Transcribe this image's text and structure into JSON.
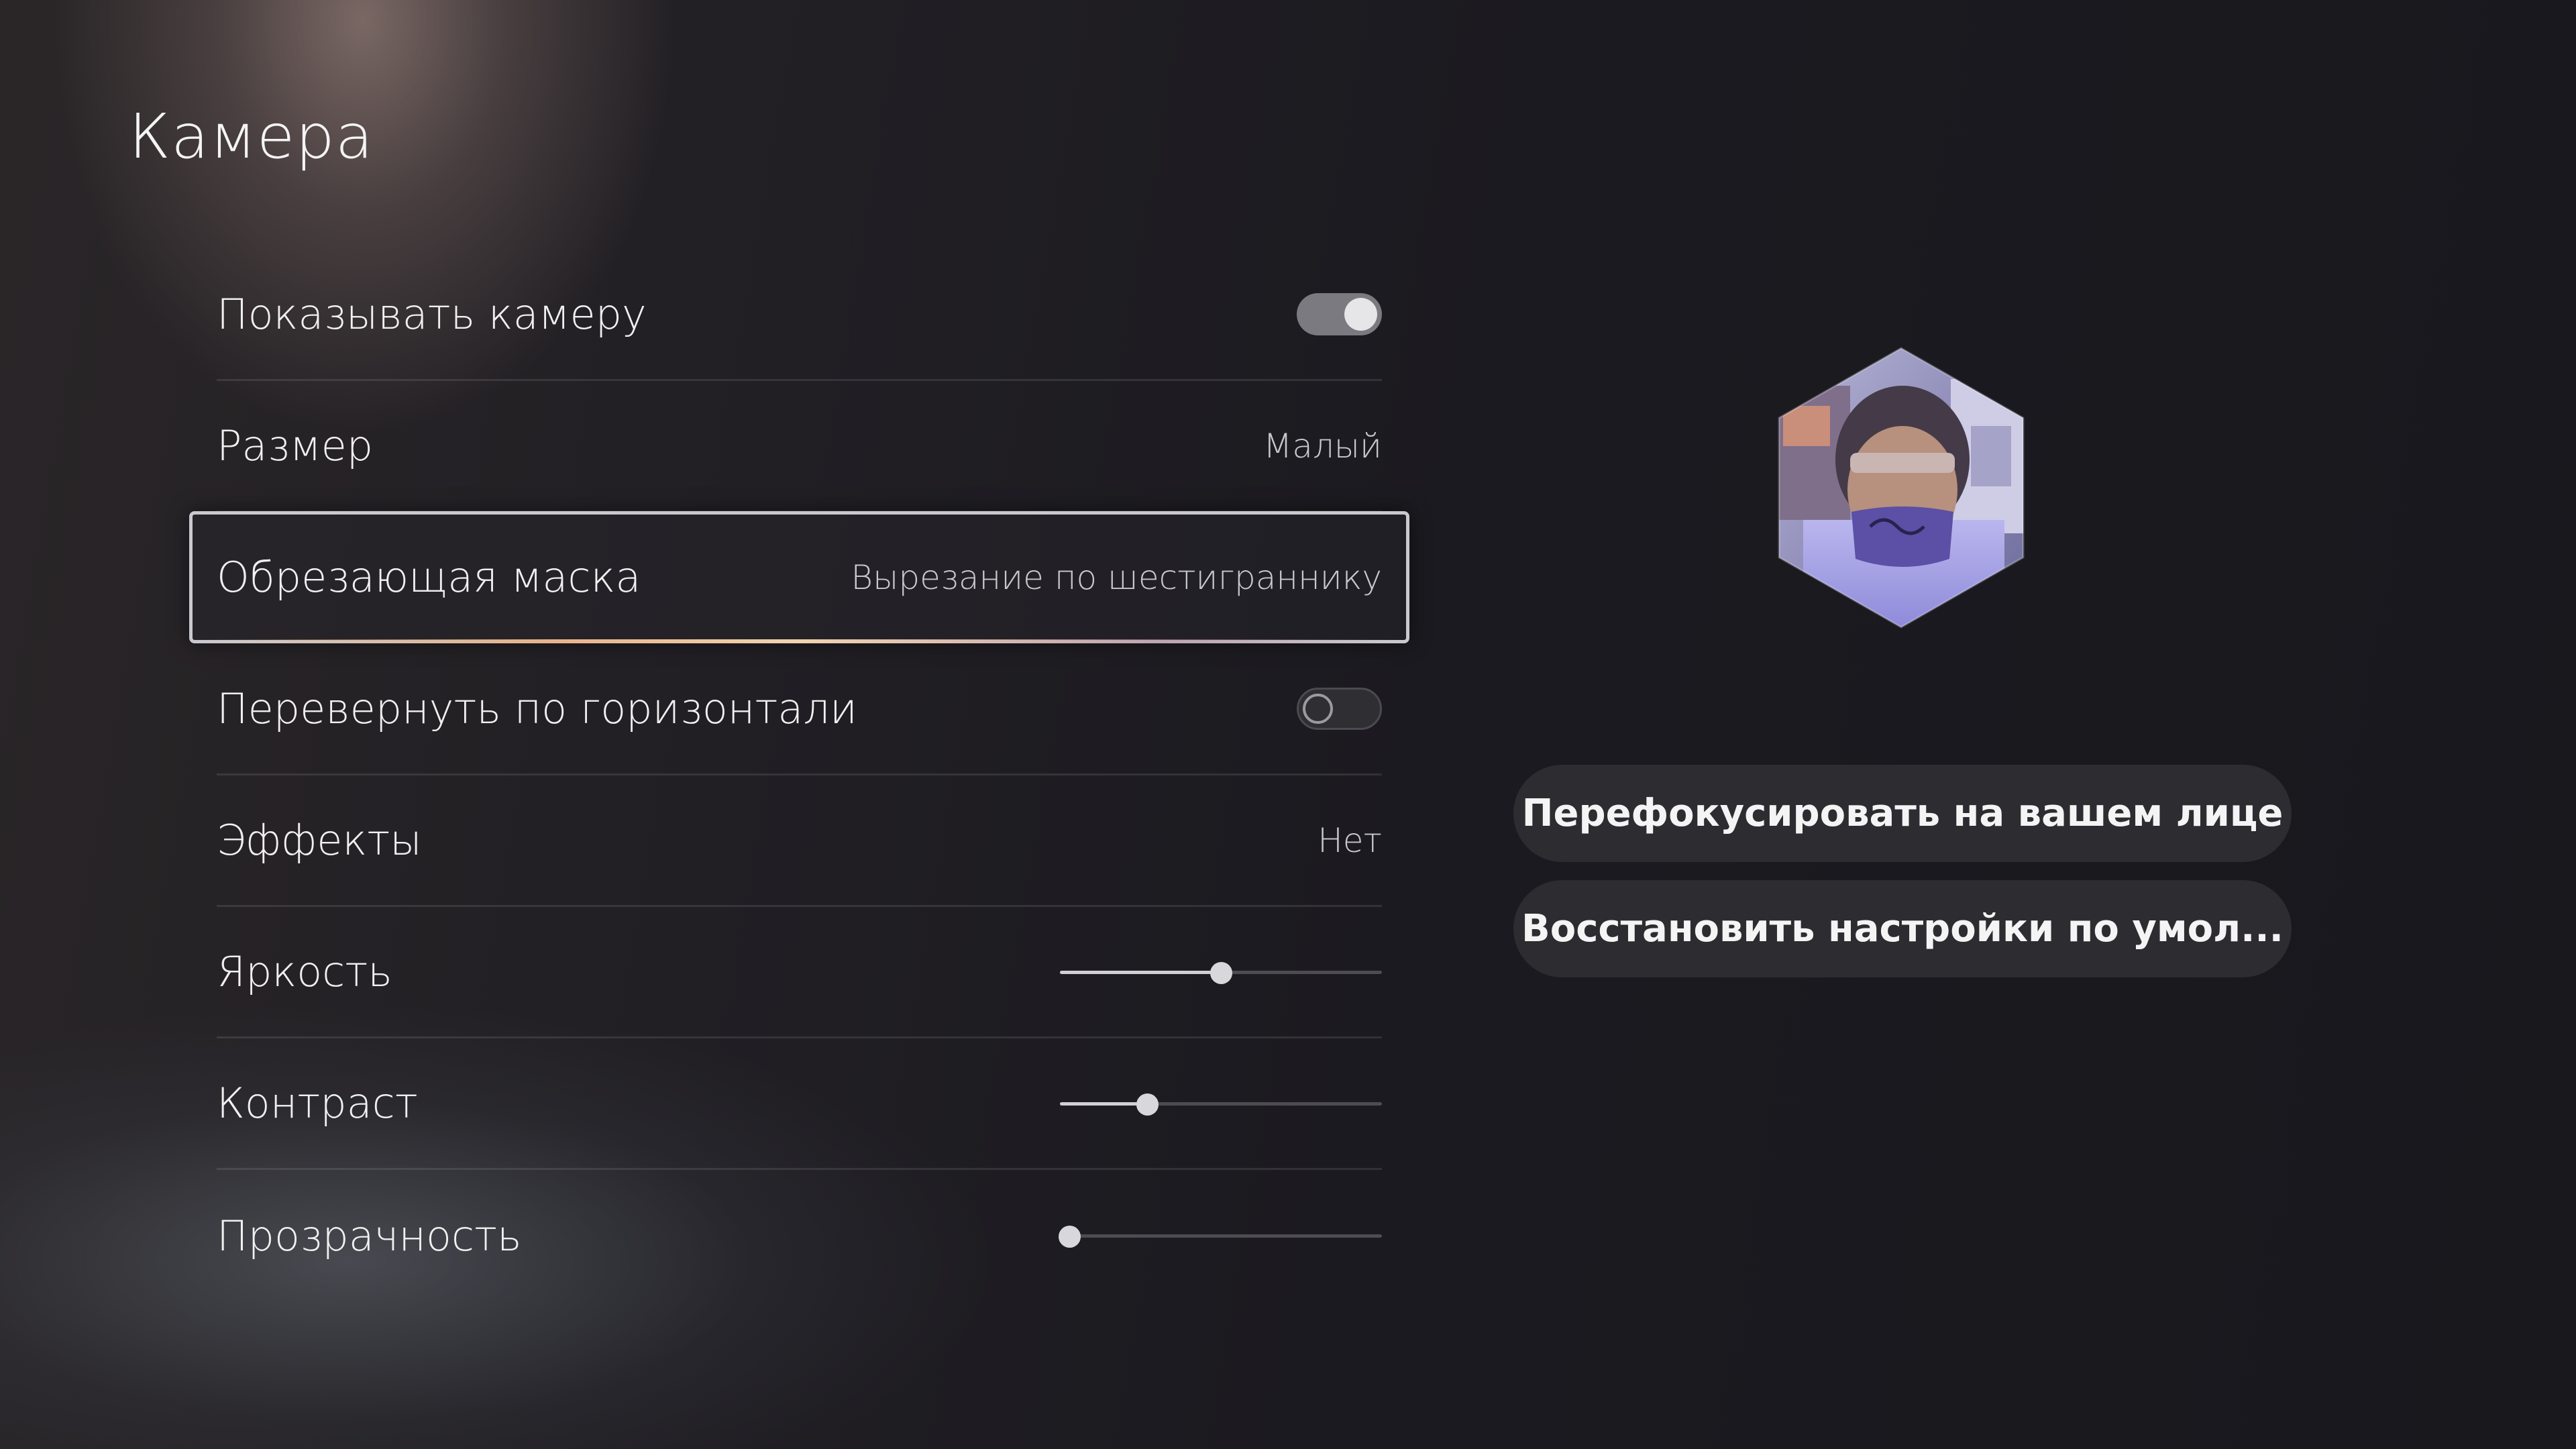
{
  "page": {
    "title": "Камера"
  },
  "settings": {
    "show_camera": {
      "label": "Показывать камеру",
      "enabled": true
    },
    "size": {
      "label": "Размер",
      "value": "Малый"
    },
    "crop_mask": {
      "label": "Обрезающая маска",
      "value": "Вырезание по шестиграннику"
    },
    "flip_horizontal": {
      "label": "Перевернуть по горизонтали",
      "enabled": false
    },
    "effects": {
      "label": "Эффекты",
      "value": "Нет"
    },
    "brightness": {
      "label": "Яркость",
      "level": 0.5
    },
    "contrast": {
      "label": "Контраст",
      "level": 0.27
    },
    "transparency": {
      "label": "Прозрачность",
      "level": 0.03
    }
  },
  "preview": {
    "icon": "camera-preview-hexagon"
  },
  "actions": {
    "refocus_label": "Перефокусировать на вашем лице",
    "reset_label": "Восстановить настройки по умол..."
  },
  "colors": {
    "toggle_on": "#7a7a80",
    "focus_accent": "#e6b48a",
    "button_bg": "#2c2c31"
  }
}
